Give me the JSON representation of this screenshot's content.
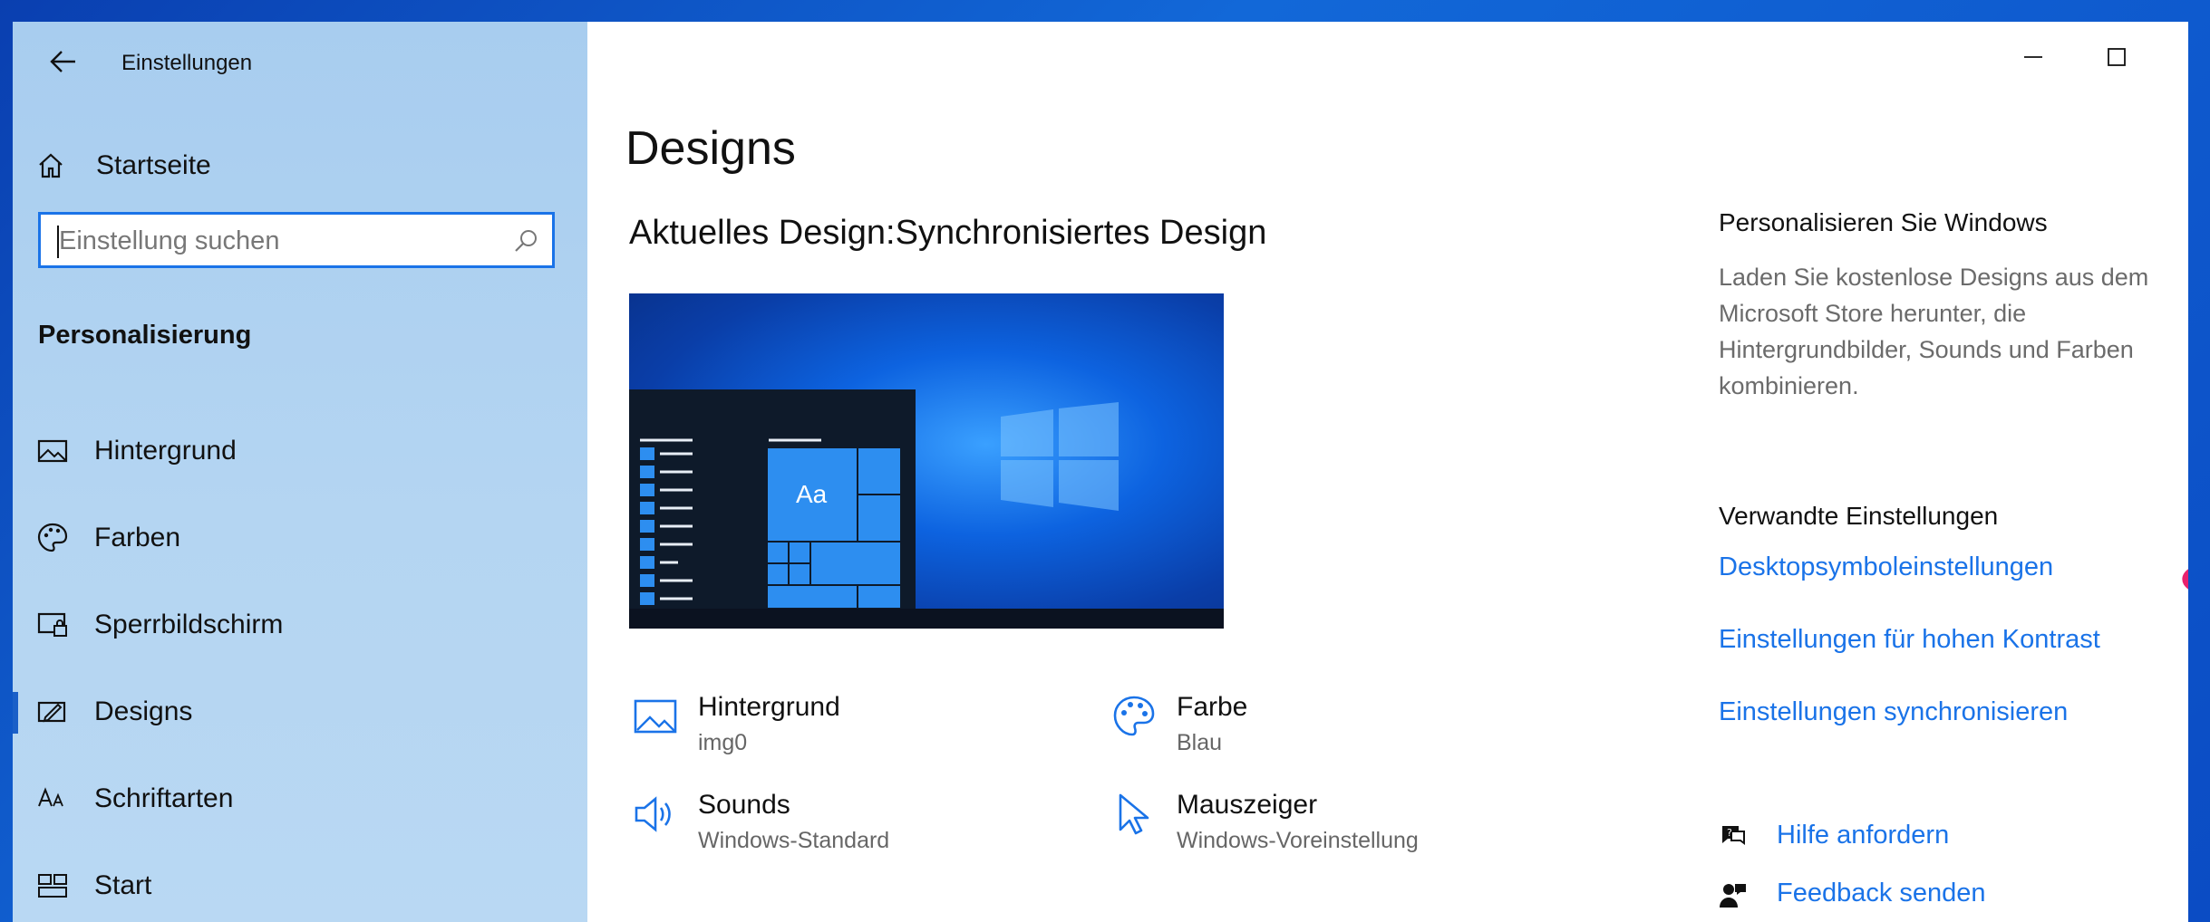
{
  "window": {
    "title": "Einstellungen"
  },
  "sidebar": {
    "home_label": "Startseite",
    "search_placeholder": "Einstellung suchen",
    "section": "Personalisierung",
    "items": [
      {
        "label": "Hintergrund",
        "icon": "image-icon"
      },
      {
        "label": "Farben",
        "icon": "palette-icon"
      },
      {
        "label": "Sperrbildschirm",
        "icon": "lock-screen-icon"
      },
      {
        "label": "Designs",
        "icon": "designs-icon",
        "active": true
      },
      {
        "label": "Schriftarten",
        "icon": "fonts-icon"
      },
      {
        "label": "Start",
        "icon": "start-icon"
      }
    ]
  },
  "main": {
    "title": "Designs",
    "current_design_label": "Aktuelles Design:",
    "current_design_value": "Synchronisiertes Design",
    "preview_tile_text": "Aa",
    "properties": [
      {
        "title": "Hintergrund",
        "value": "img0",
        "icon": "image-icon"
      },
      {
        "title": "Farbe",
        "value": "Blau",
        "icon": "palette-icon"
      },
      {
        "title": "Sounds",
        "value": "Windows-Standard",
        "icon": "speaker-icon"
      },
      {
        "title": "Mauszeiger",
        "value": "Windows-Voreinstellung",
        "icon": "cursor-icon"
      }
    ]
  },
  "right_panel": {
    "personalize_heading": "Personalisieren Sie Windows",
    "personalize_text": "Laden Sie kostenlose Designs aus dem Microsoft Store herunter, die Hintergrundbilder, Sounds und Farben kombinieren.",
    "related_heading": "Verwandte Einstellungen",
    "links": [
      "Desktopsymboleinstellungen",
      "Einstellungen für hohen Kontrast",
      "Einstellungen synchronisieren"
    ],
    "help_label": "Hilfe anfordern",
    "feedback_label": "Feedback senden"
  },
  "colors": {
    "accent": "#1a73e8",
    "sidebar": "#b4d5f2",
    "annotation": "#e8226e"
  }
}
